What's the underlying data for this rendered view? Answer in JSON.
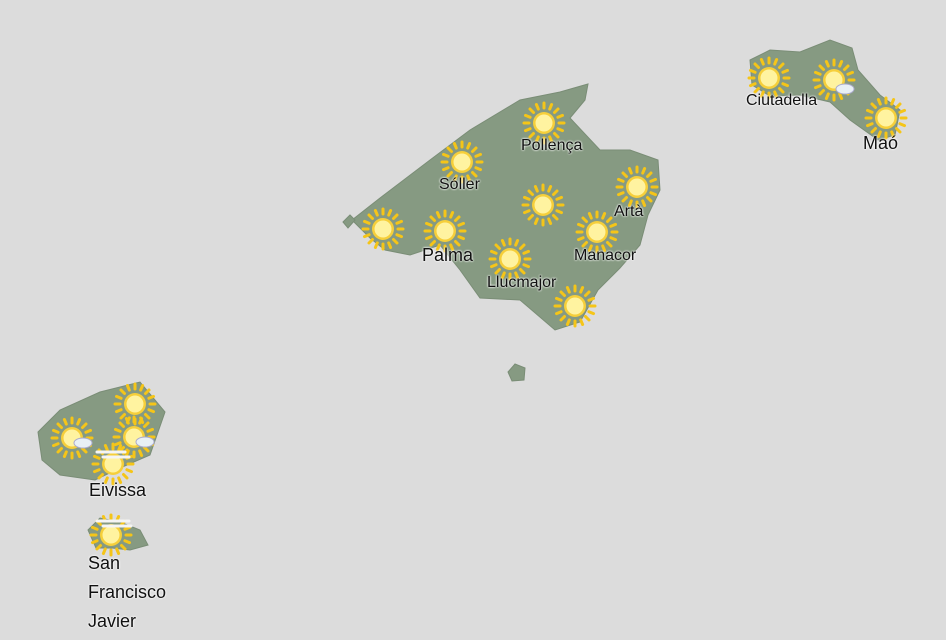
{
  "places": {
    "ciutadella": "Ciutadella",
    "mao": "Maó",
    "pollenca": "Pollença",
    "soller": "Sóller",
    "arta": "Artà",
    "palma": "Palma",
    "manacor": "Manacor",
    "llucmajor": "Llucmajor",
    "eivissa": "Eivissa",
    "san_francisco_javier": "San Francisco Javier"
  },
  "weather_icons": [
    {
      "name": "sun-icon",
      "condition": "sunny"
    },
    {
      "name": "sun-cloud-icon",
      "condition": "sunny with few clouds"
    },
    {
      "name": "sun-haze-icon",
      "condition": "sunny with haze"
    }
  ],
  "colors": {
    "background": "#dcdcdc",
    "land": "#869a82",
    "sun_core": "#fff3a0",
    "sun_ray": "#f5c518"
  }
}
